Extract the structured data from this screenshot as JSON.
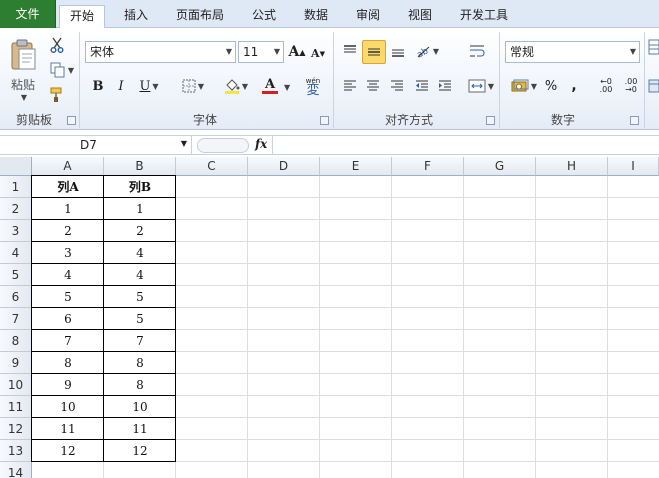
{
  "tabs": [
    "文件",
    "开始",
    "插入",
    "页面布局",
    "公式",
    "数据",
    "审阅",
    "视图",
    "开发工具"
  ],
  "ribbon": {
    "clipboard": {
      "paste_label": "粘贴",
      "group_label": "剪贴板"
    },
    "font": {
      "font_name": "宋体",
      "font_size": "11",
      "group_label": "字体",
      "bold": "B",
      "italic": "I",
      "underline": "U",
      "grow": "A",
      "shrink": "A",
      "phonetic": "wén",
      "phonetic_char": "変",
      "font_color": "A"
    },
    "alignment": {
      "group_label": "对齐方式"
    },
    "number": {
      "format": "常规",
      "group_label": "数字",
      "percent": "%",
      "comma": ",",
      "inc_decimal": ".00",
      "dec_decimal": ".00"
    }
  },
  "formula_bar": {
    "name_box": "D7",
    "fx": "fx",
    "formula": ""
  },
  "sheet": {
    "columns": [
      "A",
      "B",
      "C",
      "D",
      "E",
      "F",
      "G",
      "H",
      "I"
    ],
    "rows": [
      "1",
      "2",
      "3",
      "4",
      "5",
      "6",
      "7",
      "8",
      "9",
      "10",
      "11",
      "12",
      "13",
      "14"
    ],
    "header": [
      "列A",
      "列B"
    ],
    "data": [
      [
        "1",
        "1"
      ],
      [
        "2",
        "2"
      ],
      [
        "3",
        "4"
      ],
      [
        "4",
        "4"
      ],
      [
        "5",
        "5"
      ],
      [
        "6",
        "5"
      ],
      [
        "7",
        "7"
      ],
      [
        "8",
        "8"
      ],
      [
        "9",
        "8"
      ],
      [
        "10",
        "10"
      ],
      [
        "11",
        "11"
      ],
      [
        "12",
        "12"
      ]
    ]
  },
  "colors": {
    "file_tab": "#2e7e31",
    "ribbon_bg": "#eef3fa",
    "selected_button": "#fbd96b",
    "grid_line": "#d9dde4"
  }
}
